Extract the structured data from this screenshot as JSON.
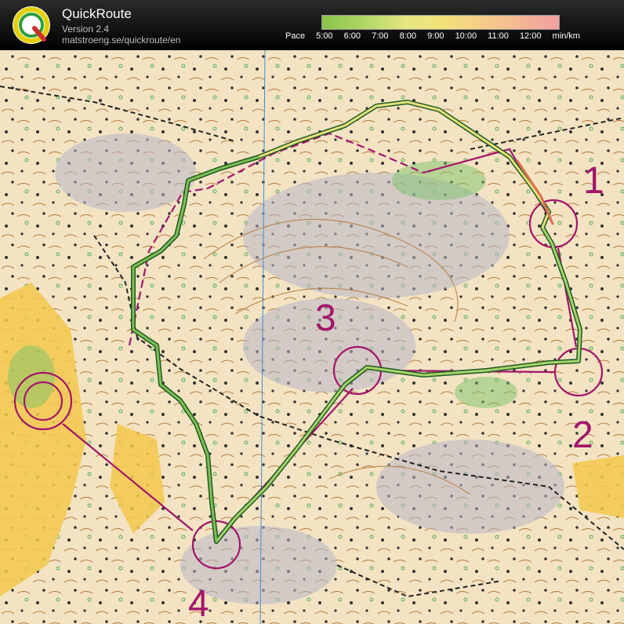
{
  "app": {
    "title": "QuickRoute",
    "version": "Version 2.4",
    "url": "matstroeng.se/quickroute/en"
  },
  "pace_legend": {
    "label": "Pace",
    "ticks": [
      "5:00",
      "6:00",
      "7:00",
      "8:00",
      "9:00",
      "10:00",
      "11:00",
      "12:00"
    ],
    "unit": "min/km",
    "colors": {
      "fast": "#8bc34a",
      "medium": "#f2e27a",
      "slow": "#f08080"
    }
  },
  "map": {
    "course_color": "#a3156b",
    "controls": [
      {
        "label": "1"
      },
      {
        "label": "2"
      },
      {
        "label": "3"
      },
      {
        "label": "4"
      }
    ]
  }
}
